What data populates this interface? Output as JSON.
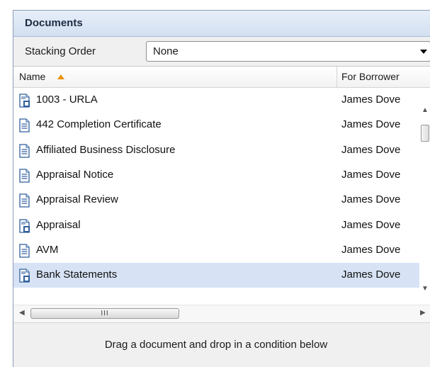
{
  "panel": {
    "title": "Documents"
  },
  "toolbar": {
    "stacking_label": "Stacking Order",
    "stacking_value": "None"
  },
  "columns": {
    "name": "Name",
    "borrower": "For Borrower"
  },
  "rows": [
    {
      "name": "1003 - URLA",
      "borrower": "James Dove",
      "icon": "multi-document-icon"
    },
    {
      "name": "442 Completion Certificate",
      "borrower": "James Dove",
      "icon": "document-icon"
    },
    {
      "name": "Affiliated Business Disclosure",
      "borrower": "James Dove",
      "icon": "document-icon"
    },
    {
      "name": "Appraisal Notice",
      "borrower": "James Dove",
      "icon": "document-icon"
    },
    {
      "name": "Appraisal Review",
      "borrower": "James Dove",
      "icon": "document-icon"
    },
    {
      "name": "Appraisal",
      "borrower": "James Dove",
      "icon": "multi-document-icon"
    },
    {
      "name": "AVM",
      "borrower": "James Dove",
      "icon": "document-icon"
    },
    {
      "name": "Bank Statements",
      "borrower": "James Dove",
      "icon": "multi-document-icon",
      "selected": true
    }
  ],
  "footer": {
    "hint": "Drag a document and drop in a condition below"
  },
  "colors": {
    "header_bg": "#d9e4f3",
    "selected_row": "#d7e3f5",
    "sort_arrow": "#e8930e"
  }
}
